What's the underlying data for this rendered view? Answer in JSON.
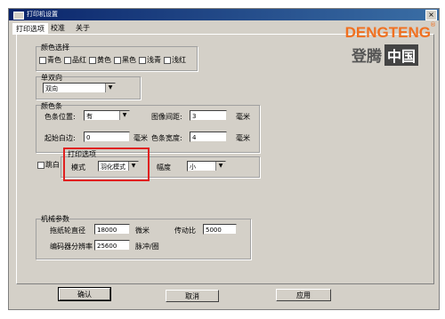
{
  "window": {
    "title": "打印机设置",
    "close_glyph": "×"
  },
  "tabs": [
    "打印选项",
    "校准",
    "关于"
  ],
  "color_select": {
    "legend": "颜色选择",
    "options": [
      "青色",
      "品红",
      "黄色",
      "黑色",
      "浅青",
      "浅红"
    ]
  },
  "direction": {
    "legend": "单双向",
    "value": "双向"
  },
  "color_bar": {
    "legend": "颜色条",
    "position_label": "色条位置:",
    "position_value": "有",
    "spacing_label": "图像间距:",
    "spacing_value": "3",
    "spacing_unit": "毫米",
    "start_label": "起始白边:",
    "start_value": "0",
    "start_unit": "毫米",
    "width_label": "色条宽度:",
    "width_value": "4",
    "width_unit": "毫米"
  },
  "jump_white": {
    "label": "跳白"
  },
  "print_options": {
    "legend": "打印选项",
    "mode_label": "模式",
    "mode_value": "羽化模式",
    "amplitude_label": "幅度",
    "amplitude_value": "小"
  },
  "mechanical": {
    "legend": "机械参数",
    "roller_label": "拖纸轮直径",
    "roller_value": "18000",
    "roller_unit": "微米",
    "ratio_label": "传动比",
    "ratio_value": "5000",
    "encoder_label": "编码器分辨率",
    "encoder_value": "25600",
    "encoder_unit": "脉冲/圈"
  },
  "buttons": {
    "ok": "确认",
    "cancel": "取消",
    "apply": "应用"
  },
  "watermark": {
    "brand": "DENGTENG",
    "reg": "®",
    "cn": "登腾",
    "cn_box": "中国"
  }
}
